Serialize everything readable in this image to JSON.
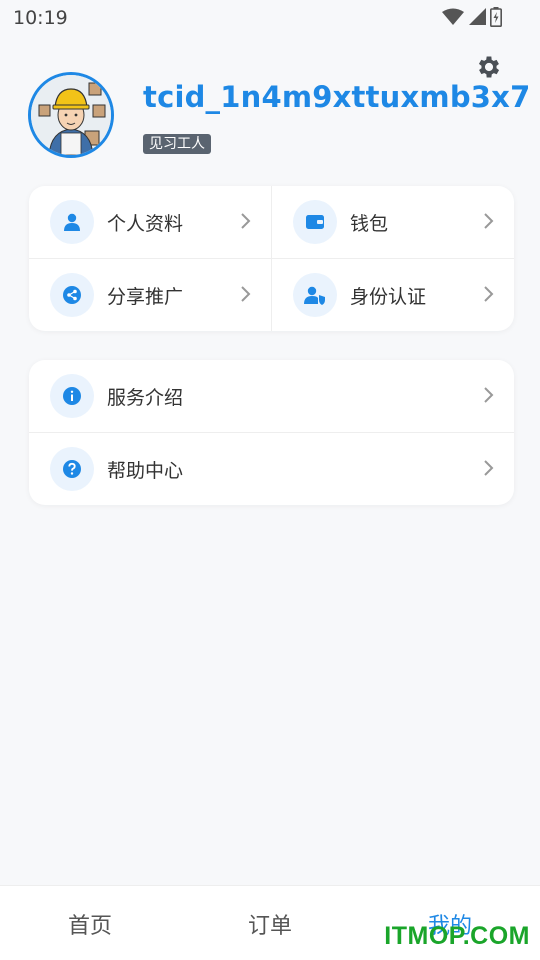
{
  "status_bar": {
    "time": "10:19",
    "icons": [
      "wifi-icon",
      "signal-icon",
      "battery-icon"
    ]
  },
  "profile": {
    "username": "tcid_1n4m9xttuxmb3x7",
    "level": "见习工人",
    "avatar": "worker-avatar"
  },
  "settings": {
    "icon": "gear-icon"
  },
  "grid_menu": [
    {
      "label": "个人资料",
      "icon": "person-icon"
    },
    {
      "label": "钱包",
      "icon": "wallet-icon"
    },
    {
      "label": "分享推广",
      "icon": "share-icon"
    },
    {
      "label": "身份认证",
      "icon": "id-verify-icon"
    }
  ],
  "list_menu": [
    {
      "label": "服务介绍",
      "icon": "info-icon"
    },
    {
      "label": "帮助中心",
      "icon": "help-icon"
    }
  ],
  "tab_bar": {
    "tabs": [
      {
        "label": "首页",
        "active": false
      },
      {
        "label": "订单",
        "active": false
      },
      {
        "label": "我的",
        "active": true
      }
    ]
  },
  "watermark": "ITMOP.COM",
  "colors": {
    "accent": "#1e88e5",
    "icon_bg": "#eaf3fd",
    "badge_bg": "#5a6470",
    "watermark": "#1aa52a"
  }
}
